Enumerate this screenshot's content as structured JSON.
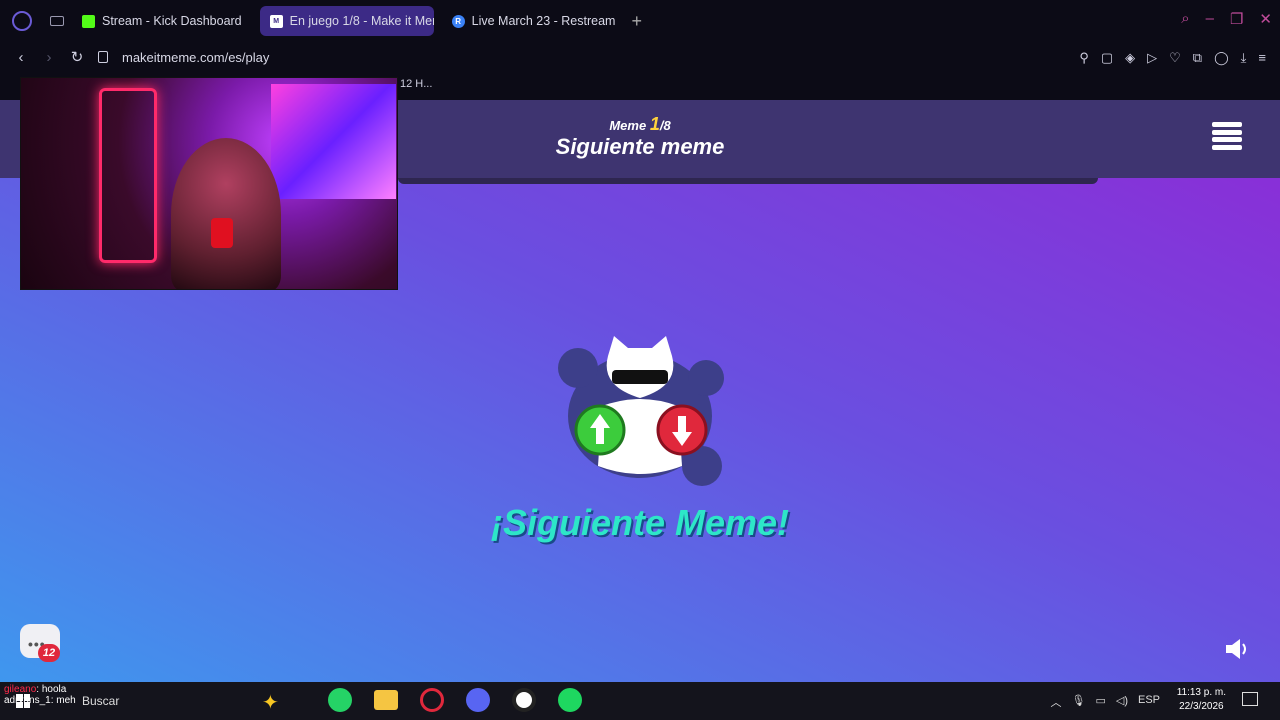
{
  "browser": {
    "tabs": [
      {
        "label": "Stream - Kick Dashboard",
        "favicon": "kick-icon"
      },
      {
        "label": "En juego 1/8 - Make it Meme",
        "favicon": "makeitmeme-icon",
        "active": true
      },
      {
        "label": "Live March 23 - Restream",
        "favicon": "restream-icon"
      }
    ],
    "url": "makeitmeme.com/es/play",
    "bookmark_text": "12 H..."
  },
  "game": {
    "meme_prefix": "Meme",
    "meme_current": "1",
    "meme_total": "/8",
    "header_title": "Siguiente meme",
    "next_label": "¡Siguiente Meme!",
    "chat_badge_count": "12",
    "colors": {
      "header": "#3e3470",
      "next_label": "#2de6c8",
      "up_button": "#3ccc3c",
      "down_button": "#e0283c"
    }
  },
  "stream_chat": [
    {
      "user": "gileano",
      "message": ": hoola"
    },
    {
      "user": "adryans_1",
      "message": ": meh"
    }
  ],
  "taskbar": {
    "search_placeholder": "Buscar",
    "language": "ESP",
    "time": "11:13 p. m.",
    "date": "22/3/2026",
    "apps": [
      "whatsapp-icon",
      "file-explorer-icon",
      "opera-gx-icon",
      "discord-icon",
      "obs-icon",
      "spotify-icon"
    ]
  }
}
